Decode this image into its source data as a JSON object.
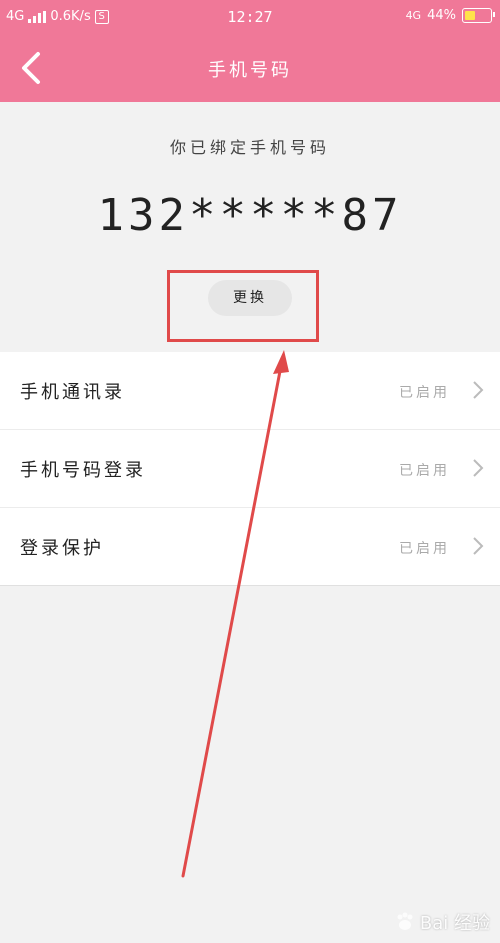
{
  "statusbar": {
    "network": "4G",
    "speed": "0.6K/s",
    "s_badge": "S",
    "time": "12:27",
    "network_right": "4G",
    "battery_percent": "44%"
  },
  "header": {
    "title": "手机号码"
  },
  "main": {
    "subtitle": "你已绑定手机号码",
    "phone": "132*****87",
    "change_label": "更换"
  },
  "list": [
    {
      "label": "手机通讯录",
      "status": "已启用"
    },
    {
      "label": "手机号码登录",
      "status": "已启用"
    },
    {
      "label": "登录保护",
      "status": "已启用"
    }
  ],
  "watermark": {
    "text": "Bai 经验"
  },
  "colors": {
    "accent": "#f07898",
    "annotation": "#e04a4a"
  }
}
